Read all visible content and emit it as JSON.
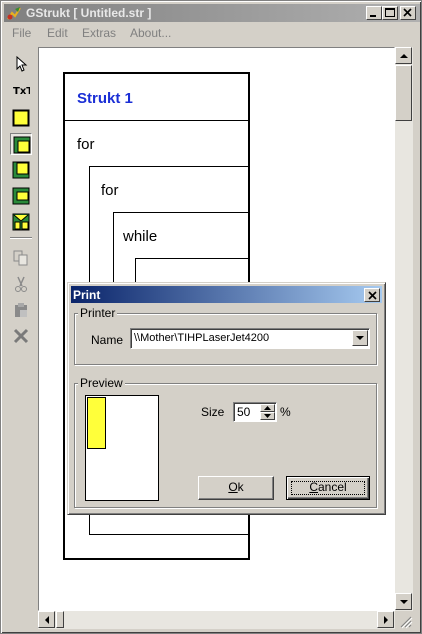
{
  "window": {
    "title": "GStrukt [ Untitled.str ]",
    "icon": "gstrukt-app-icon"
  },
  "menu": {
    "items": [
      "File",
      "Edit",
      "Extras",
      "About..."
    ]
  },
  "toolbar": {
    "tools": [
      "pointer-tool",
      "text-tool",
      "statement-block-tool",
      "for-loop-tool",
      "repeat-loop-tool",
      "while-loop-tool",
      "branch-tool",
      "copy-tool",
      "cut-tool",
      "paste-tool",
      "delete-tool"
    ]
  },
  "diagram": {
    "title": "Strukt 1",
    "loop1": "for",
    "loop2": "for",
    "loop3": "while"
  },
  "print_dialog": {
    "title": "Print",
    "printer_group": "Printer",
    "name_label": "Name",
    "printer_value": "\\\\Mother\\TIHPLaserJet4200",
    "preview_group": "Preview",
    "size_label": "Size",
    "size_value": "50",
    "size_unit": "%",
    "ok_label": "Ok",
    "ok_accel": "O",
    "ok_rest": "k",
    "cancel_label": "Cancel",
    "cancel_accel": "C",
    "cancel_rest": "ancel"
  },
  "colors": {
    "diagram_title": "#1b2fd6",
    "preview_fill": "#ffff3a",
    "dialog_title_start": "#0a246a"
  }
}
